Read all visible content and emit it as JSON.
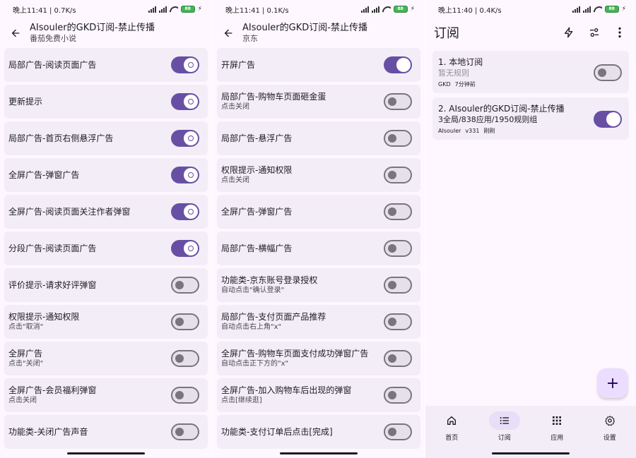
{
  "screen1": {
    "status": {
      "time_speed": "晚上11:41 | 0.7K/s",
      "battery": "88"
    },
    "title": "AIsouler的GKD订阅-禁止传播",
    "subtitle": "番茄免费小说",
    "rules": [
      {
        "label": "局部广告-阅读页面广告",
        "sub": "",
        "on": true
      },
      {
        "label": "更新提示",
        "sub": "",
        "on": true
      },
      {
        "label": "局部广告-首页右侧悬浮广告",
        "sub": "",
        "on": true
      },
      {
        "label": "全屏广告-弹窗广告",
        "sub": "",
        "on": true
      },
      {
        "label": "全屏广告-阅读页面关注作者弹窗",
        "sub": "",
        "on": true
      },
      {
        "label": "分段广告-阅读页面广告",
        "sub": "",
        "on": true
      },
      {
        "label": "评价提示-请求好评弹窗",
        "sub": "",
        "on": false
      },
      {
        "label": "权限提示-通知权限",
        "sub": "点击\"取消\"",
        "on": false
      },
      {
        "label": "全屏广告",
        "sub": "点击\"关闭\"",
        "on": false
      },
      {
        "label": "全屏广告-会员福利弹窗",
        "sub": "点击关闭",
        "on": false
      },
      {
        "label": "功能类-关闭广告声音",
        "sub": "",
        "on": false
      }
    ]
  },
  "screen2": {
    "status": {
      "time_speed": "晚上11:41 | 0.1K/s",
      "battery": "88"
    },
    "title": "AIsouler的GKD订阅-禁止传播",
    "subtitle": "京东",
    "rules": [
      {
        "label": "开屏广告",
        "sub": "",
        "on": true
      },
      {
        "label": "局部广告-购物车页面砸金蛋",
        "sub": "点击关闭",
        "on": false
      },
      {
        "label": "局部广告-悬浮广告",
        "sub": "",
        "on": false
      },
      {
        "label": "权限提示-通知权限",
        "sub": "点击关闭",
        "on": false
      },
      {
        "label": "全屏广告-弹窗广告",
        "sub": "",
        "on": false
      },
      {
        "label": "局部广告-横幅广告",
        "sub": "",
        "on": false
      },
      {
        "label": "功能类-京东账号登录授权",
        "sub": "自动点击\"确认登录\"",
        "on": false
      },
      {
        "label": "局部广告-支付页面产品推荐",
        "sub": "自动点击右上角\"x\"",
        "on": false
      },
      {
        "label": "全屏广告-购物车页面支付成功弹窗广告",
        "sub": "自动点击正下方的\"x\"",
        "on": false
      },
      {
        "label": "全屏广告-加入购物车后出现的弹窗",
        "sub": "点击[继续逛]",
        "on": false
      },
      {
        "label": "功能类-支付订单后点击[完成]",
        "sub": "",
        "on": false
      }
    ]
  },
  "screen3": {
    "status": {
      "time_speed": "晚上11:40 | 0.4K/s",
      "battery": "88"
    },
    "title": "订阅",
    "subscriptions": [
      {
        "title": "1. 本地订阅",
        "desc": "暂无规则",
        "meta": [
          "GKD",
          "7分钟前"
        ],
        "on": false,
        "muted": true
      },
      {
        "title": "2. AIsouler的GKD订阅-禁止传播",
        "desc": "3全局/838应用/1950规则组",
        "meta": [
          "AIsouler",
          "v331",
          "刚刚"
        ],
        "on": true,
        "muted": false
      }
    ],
    "fab_label": "+",
    "nav": [
      {
        "label": "首页",
        "icon": "home-icon",
        "active": false
      },
      {
        "label": "订阅",
        "icon": "list-icon",
        "active": true
      },
      {
        "label": "应用",
        "icon": "apps-grid-icon",
        "active": false
      },
      {
        "label": "设置",
        "icon": "gear-icon",
        "active": false
      }
    ]
  },
  "colors": {
    "background": "#fef7ff",
    "card": "#f3edf7",
    "switch_on": "#6750a4",
    "switch_off_track": "#e6e0e9",
    "fab": "#eaddff"
  }
}
